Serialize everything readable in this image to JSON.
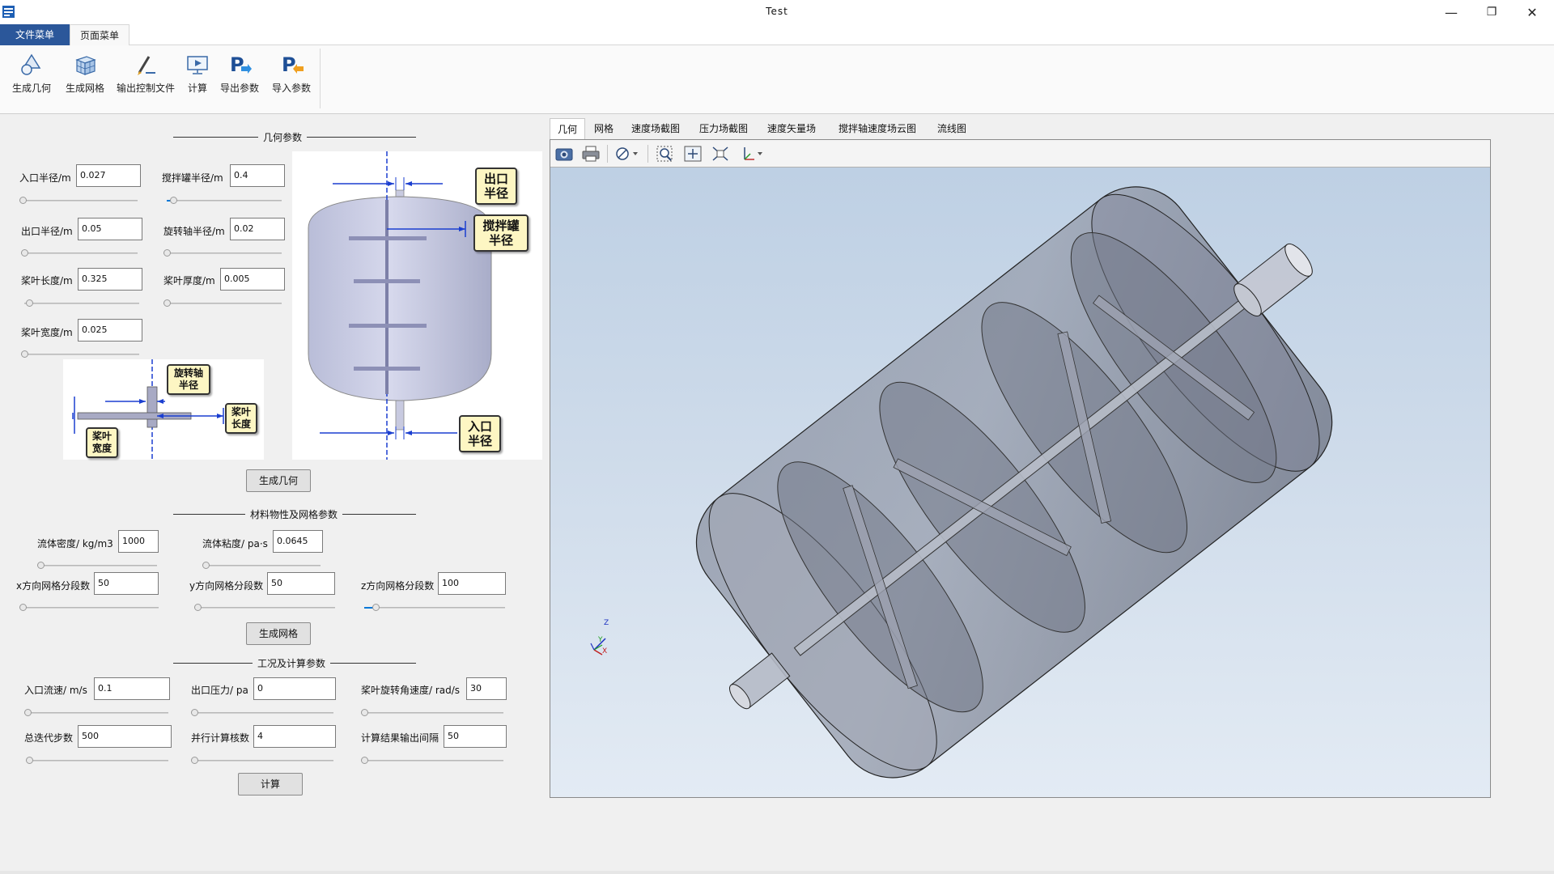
{
  "window": {
    "title": "Test",
    "minimize": "—",
    "maximize": "❐",
    "close": "✕"
  },
  "menu_tabs": [
    "文件菜单",
    "页面菜单"
  ],
  "ribbon": {
    "buttons": [
      {
        "label": "生成几何",
        "icon": "geometry-icon"
      },
      {
        "label": "生成网格",
        "icon": "mesh-cube-icon"
      },
      {
        "label": "输出控制文件",
        "icon": "pen-edit-icon"
      },
      {
        "label": "计算",
        "icon": "monitor-play-icon"
      },
      {
        "label": "导出参数",
        "icon": "export-p-icon"
      },
      {
        "label": "导入参数",
        "icon": "import-p-icon"
      }
    ]
  },
  "geometry": {
    "section_title": "几何参数",
    "fields": {
      "inlet_radius": {
        "label": "入口半径/m",
        "value": "0.027",
        "slider": 0.03
      },
      "tank_radius": {
        "label": "搅拌罐半径/m",
        "value": "0.4",
        "slider": 0.05
      },
      "outlet_radius": {
        "label": "出口半径/m",
        "value": "0.05",
        "slider": 0.0
      },
      "shaft_radius": {
        "label": "旋转轴半径/m",
        "value": "0.02",
        "slider": 0.0
      },
      "blade_length": {
        "label": "桨叶长度/m",
        "value": "0.325",
        "slider": 0.05
      },
      "blade_thickness": {
        "label": "桨叶厚度/m",
        "value": "0.005",
        "slider": 0.0
      },
      "blade_width": {
        "label": "桨叶宽度/m",
        "value": "0.025",
        "slider": 0.0
      }
    },
    "diagram_blade": {
      "shaft_radius": [
        "旋转轴",
        "半径"
      ],
      "blade_length": [
        "桨叶",
        "长度"
      ],
      "blade_width": [
        "桨叶",
        "宽度"
      ]
    },
    "diagram_tank": {
      "outlet": [
        "出口",
        "半径"
      ],
      "tank": [
        "搅拌罐",
        "半径"
      ],
      "inlet": [
        "入口",
        "半径"
      ]
    },
    "button": "生成几何"
  },
  "material": {
    "section_title": "材料物性及网格参数",
    "fields": {
      "density": {
        "label": "流体密度/ kg/m3",
        "value": "1000",
        "slider": 0.0
      },
      "viscosity": {
        "label": "流体粘度/ pa·s",
        "value": "0.0645",
        "slider": 0.0
      },
      "x_segments": {
        "label": "x方向网格分段数",
        "value": "50",
        "slider": 0.0
      },
      "y_segments": {
        "label": "y方向网格分段数",
        "value": "50",
        "slider": 0.0
      },
      "z_segments": {
        "label": "z方向网格分段数",
        "value": "100",
        "slider": 0.05
      }
    },
    "button": "生成网格"
  },
  "computation": {
    "section_title": "工况及计算参数",
    "fields": {
      "inlet_velocity": {
        "label": "入口流速/ m/s",
        "value": "0.1",
        "slider": 0.0
      },
      "outlet_pressure": {
        "label": "出口压力/ pa",
        "value": "0",
        "slider": 0.0
      },
      "blade_speed": {
        "label": "桨叶旋转角速度/ rad/s",
        "value": "30",
        "slider": 0.0
      },
      "iterations": {
        "label": "总迭代步数",
        "value": "500",
        "slider": 0.0
      },
      "cores": {
        "label": "并行计算核数",
        "value": "4",
        "slider": 0.0
      },
      "output_interval": {
        "label": "计算结果输出间隔",
        "value": "50",
        "slider": 0.0
      }
    },
    "button": "计算"
  },
  "viewer": {
    "tabs": [
      "几何",
      "网格",
      "速度场截图",
      "压力场截图",
      "速度矢量场",
      "搅拌轴速度场云图",
      "流线图"
    ],
    "active_tab": 0,
    "toolbar": [
      "camera-icon",
      "print-icon",
      "visibility-icon",
      "zoom-box-icon",
      "fit-all-icon",
      "zoom-extents-icon",
      "axes-icon"
    ],
    "axes": {
      "z": "Z",
      "y": "Y",
      "x": "X"
    }
  }
}
